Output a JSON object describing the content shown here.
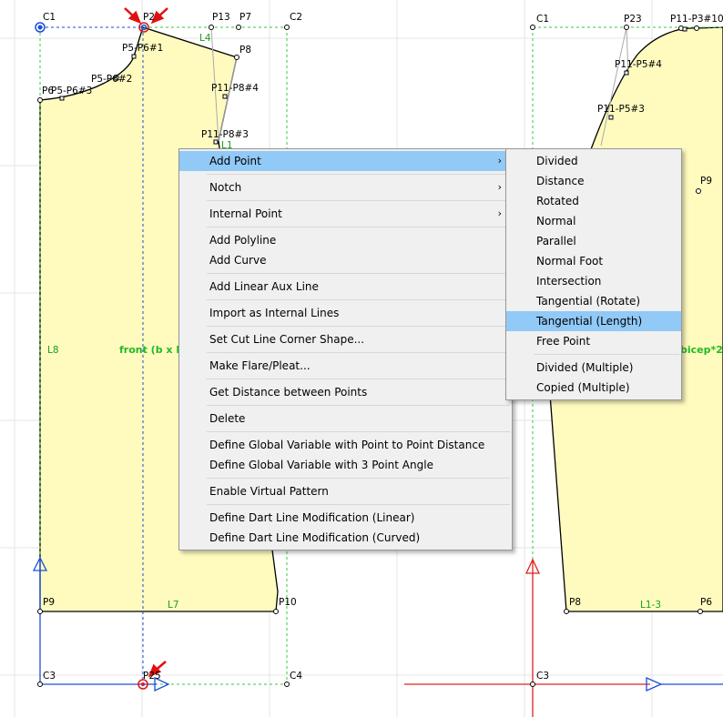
{
  "canvas": {
    "corner_labels": [
      "C1",
      "C2",
      "C3",
      "C4",
      "C1",
      "C3"
    ],
    "point_labels": [
      "P5-P6#1",
      "P5-P6#2",
      "P5-P6#3",
      "P6",
      "P2",
      "P13",
      "P7",
      "P8",
      "P11-P8#4",
      "P11-P8#3",
      "P9",
      "P10",
      "P25"
    ],
    "line_labels": [
      "L4",
      "L1",
      "L8",
      "L7"
    ],
    "pattern_label_left": "front (b x le",
    "right_point_labels": [
      "P23",
      "P11-P3#10",
      "P11-P5#4",
      "P11-P5#3",
      "P9",
      "P8",
      "P6"
    ],
    "right_line_labels": [
      "L1-3"
    ],
    "pattern_label_right": "bicep*2"
  },
  "context_menu": {
    "items": [
      {
        "label": "Add Point",
        "submenu": true,
        "highlighted": true
      },
      {
        "sep": true
      },
      {
        "label": "Notch",
        "submenu": true
      },
      {
        "sep": true
      },
      {
        "label": "Internal Point",
        "submenu": true
      },
      {
        "sep": true
      },
      {
        "label": "Add Polyline"
      },
      {
        "label": "Add Curve"
      },
      {
        "sep": true
      },
      {
        "label": "Add Linear Aux Line"
      },
      {
        "sep": true
      },
      {
        "label": "Import as Internal Lines"
      },
      {
        "sep": true
      },
      {
        "label": "Set Cut Line Corner Shape..."
      },
      {
        "sep": true
      },
      {
        "label": "Make Flare/Pleat..."
      },
      {
        "sep": true
      },
      {
        "label": "Get Distance between Points"
      },
      {
        "sep": true
      },
      {
        "label": "Delete"
      },
      {
        "sep": true
      },
      {
        "label": "Define Global Variable with Point to Point Distance"
      },
      {
        "label": "Define Global Variable with 3 Point Angle"
      },
      {
        "sep": true
      },
      {
        "label": "Enable Virtual Pattern"
      },
      {
        "sep": true
      },
      {
        "label": "Define Dart Line Modification (Linear)"
      },
      {
        "label": "Define Dart Line Modification (Curved)"
      }
    ]
  },
  "submenu": {
    "items": [
      {
        "label": "Divided"
      },
      {
        "label": "Distance"
      },
      {
        "label": "Rotated"
      },
      {
        "label": "Normal"
      },
      {
        "label": "Parallel"
      },
      {
        "label": "Normal Foot"
      },
      {
        "label": "Intersection"
      },
      {
        "label": "Tangential (Rotate)"
      },
      {
        "label": "Tangential (Length)",
        "highlighted": true
      },
      {
        "label": "Free Point"
      },
      {
        "sep": true
      },
      {
        "label": "Divided (Multiple)"
      },
      {
        "label": "Copied (Multiple)"
      }
    ]
  },
  "colors": {
    "pattern_fill": "#fffbbf",
    "green_dashed": "#33cc33",
    "blue_axis": "#1a4fd6",
    "red_axis": "#e02020",
    "highlight": "#91c9f7",
    "menu_bg": "#f0f0f0"
  },
  "icons": [
    "red-arrow-icon",
    "blue-arrow-icon",
    "target-icon"
  ]
}
